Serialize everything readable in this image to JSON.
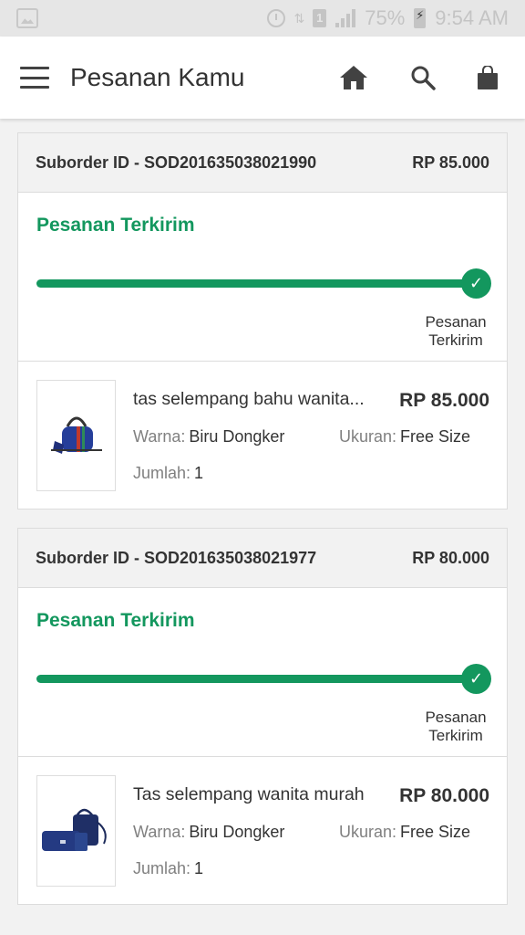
{
  "status_bar": {
    "battery": "75%",
    "time": "9:54 AM",
    "sim_label": "1",
    "icons": [
      "image-icon",
      "alarm-icon",
      "data-icon",
      "sim-icon",
      "signal-icon",
      "battery-icon"
    ]
  },
  "app_bar": {
    "title": "Pesanan Kamu",
    "icons": [
      "menu-icon",
      "home-icon",
      "search-icon",
      "bag-icon"
    ]
  },
  "orders": [
    {
      "suborder_label": "Suborder ID - SOD201635038021990",
      "total": "RP 85.000",
      "status_title": "Pesanan Terkirim",
      "step_label_line1": "Pesanan",
      "step_label_line2": "Terkirim",
      "progress_fraction": 1.0,
      "item": {
        "name": "tas selempang bahu wanita...",
        "price": "RP 85.000",
        "color_label": "Warna:",
        "color_value": "Biru Dongker",
        "size_label": "Ukuran:",
        "size_value": "Free Size",
        "qty_label": "Jumlah:",
        "qty_value": "1"
      }
    },
    {
      "suborder_label": "Suborder ID - SOD201635038021977",
      "total": "RP 80.000",
      "status_title": "Pesanan Terkirim",
      "step_label_line1": "Pesanan",
      "step_label_line2": "Terkirim",
      "progress_fraction": 1.0,
      "item": {
        "name": "Tas selempang wanita murah",
        "price": "RP 80.000",
        "color_label": "Warna:",
        "color_value": "Biru Dongker",
        "size_label": "Ukuran:",
        "size_value": "Free Size",
        "qty_label": "Jumlah:",
        "qty_value": "1"
      }
    }
  ],
  "colors": {
    "accent_green": "#13975e",
    "header_bg": "#f2f2f2",
    "status_bar_bg": "#e6e6e6"
  }
}
